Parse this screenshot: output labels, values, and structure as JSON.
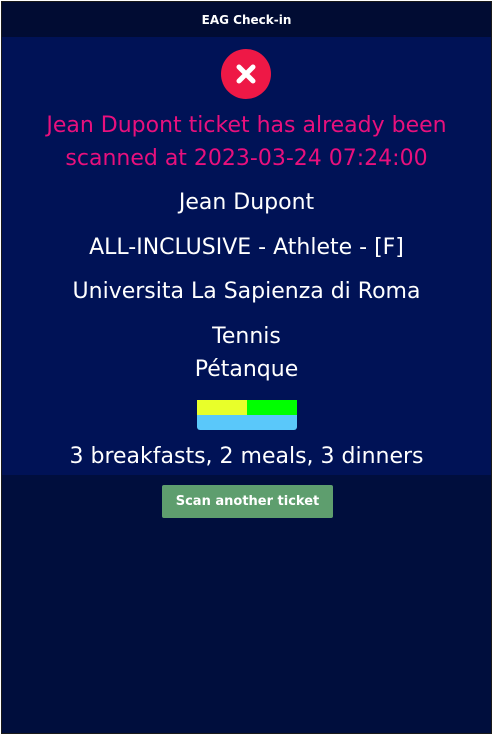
{
  "header": {
    "title": "EAG Check-in"
  },
  "status": {
    "icon": "error-x-icon",
    "color": "#ee1846",
    "message": "Jean Dupont ticket has already been scanned at 2023-03-24 07:24:00",
    "message_color": "#e8107d"
  },
  "attendee": {
    "name": "Jean Dupont",
    "ticket_type": "ALL-INCLUSIVE - Athlete - [F]",
    "university": "Universita La Sapienza di Roma",
    "sports": [
      "Tennis",
      "Pétanque"
    ]
  },
  "meals": {
    "indicator_colors": [
      "#e8ff2a",
      "#00ff00",
      "#5ac8fa"
    ],
    "summary": "3 breakfasts, 2 meals, 3 dinners"
  },
  "actions": {
    "scan_another_label": "Scan another ticket"
  }
}
